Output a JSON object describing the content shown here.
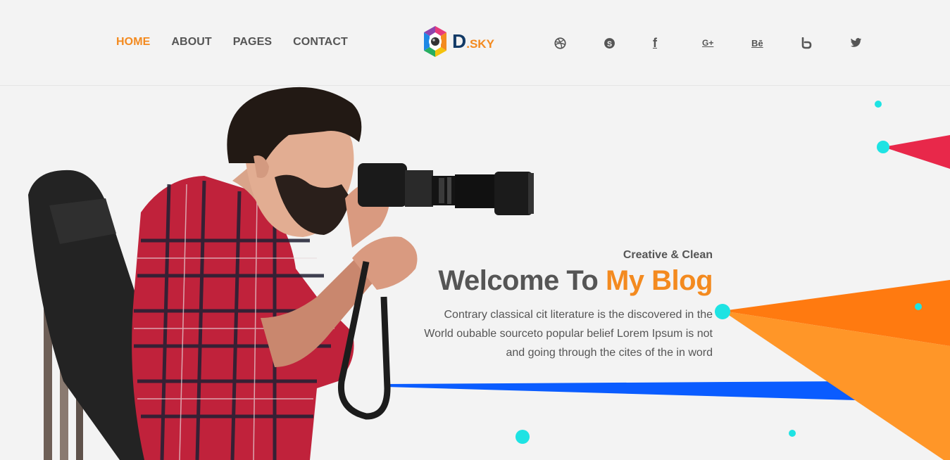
{
  "nav": {
    "items": [
      {
        "label": "HOME",
        "active": true
      },
      {
        "label": "ABOUT",
        "active": false
      },
      {
        "label": "PAGES",
        "active": false
      },
      {
        "label": "CONTACT",
        "active": false
      }
    ]
  },
  "logo": {
    "letter": "D",
    "rest": ".SKY"
  },
  "social": {
    "icons": [
      "dribbble-icon",
      "skype-icon",
      "facebook-icon",
      "google-plus-icon",
      "behance-icon",
      "blogger-icon",
      "twitter-icon"
    ],
    "facebook_glyph": "f",
    "google_glyph": "G+",
    "behance_glyph": "Bē"
  },
  "hero": {
    "kicker": "Creative & Clean",
    "headline_plain": "Welcome To",
    "headline_accent": "My Blog",
    "description_lines": [
      "Contrary classical cit literature is the discovered in the",
      "World oubable sourceto popular belief Lorem Ipsum is not",
      "and going through the cites of the in word"
    ]
  },
  "colors": {
    "accent": "#f38a1f",
    "text": "#555555",
    "logo_dark": "#123a66",
    "shape_red": "#e8284a",
    "shape_orange": "#ff7a10",
    "shape_blue": "#0a5cff",
    "dot_cyan": "#1ee3e3"
  }
}
